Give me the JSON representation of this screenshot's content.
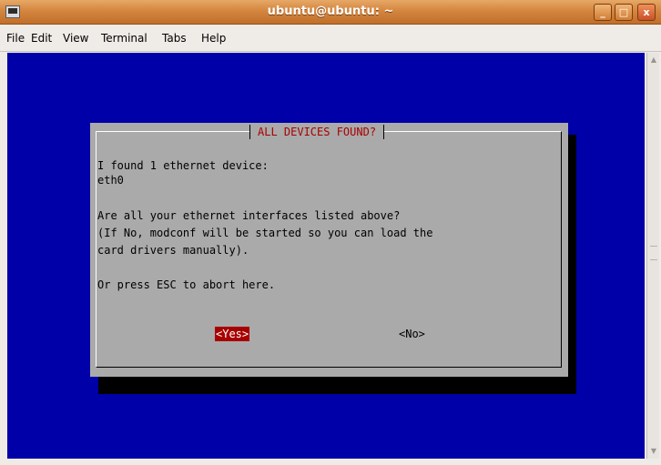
{
  "window": {
    "title": "ubuntu@ubuntu: ~",
    "minimize": "_",
    "maximize": "□",
    "close": "x"
  },
  "menu": {
    "items": [
      "File",
      "Edit",
      "View",
      "Terminal",
      "Tabs",
      "Help"
    ]
  },
  "dialog": {
    "title": "ALL DEVICES FOUND?",
    "lines": [
      "I found 1 ethernet device:",
      "eth0",
      "",
      "Are all your ethernet interfaces listed above?",
      "(If No, modconf will be started so you can load the",
      "card drivers manually).",
      "",
      "Or press ESC to abort here."
    ],
    "yes_label": "<Yes>",
    "no_label": "<No>"
  },
  "colors": {
    "terminal_bg": "#0000a8",
    "dialog_bg": "#aaaaaa",
    "accent": "#a80000"
  }
}
